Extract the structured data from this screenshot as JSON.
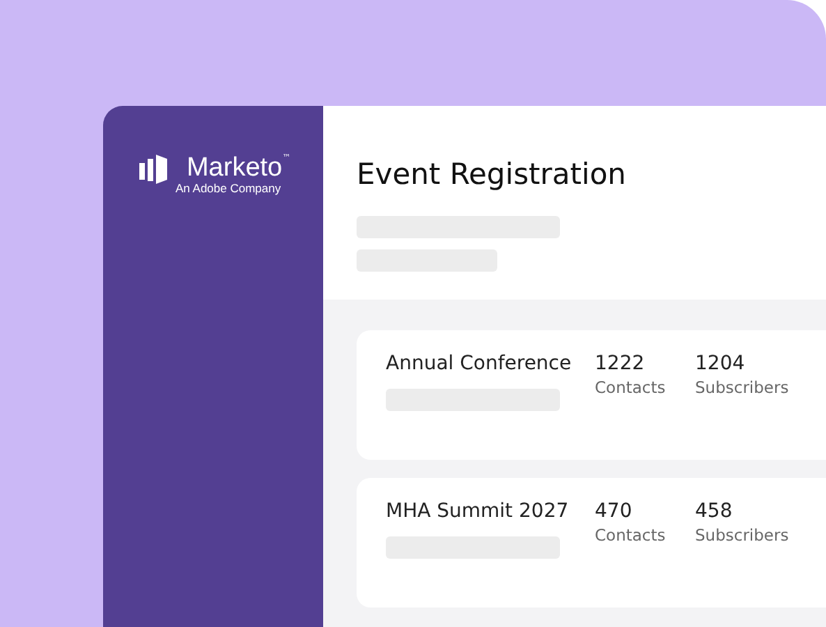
{
  "sidebar": {
    "logo": {
      "name": "Marketo",
      "trademark": "™",
      "tagline": "An Adobe Company"
    }
  },
  "header": {
    "title": "Event Registration"
  },
  "events": [
    {
      "name": "Annual Conference",
      "stats": [
        {
          "value": "1222",
          "label": "Contacts"
        },
        {
          "value": "1204",
          "label": "Subscribers"
        }
      ]
    },
    {
      "name": "MHA Summit 2027",
      "stats": [
        {
          "value": "470",
          "label": "Contacts"
        },
        {
          "value": "458",
          "label": "Subscribers"
        }
      ]
    }
  ]
}
